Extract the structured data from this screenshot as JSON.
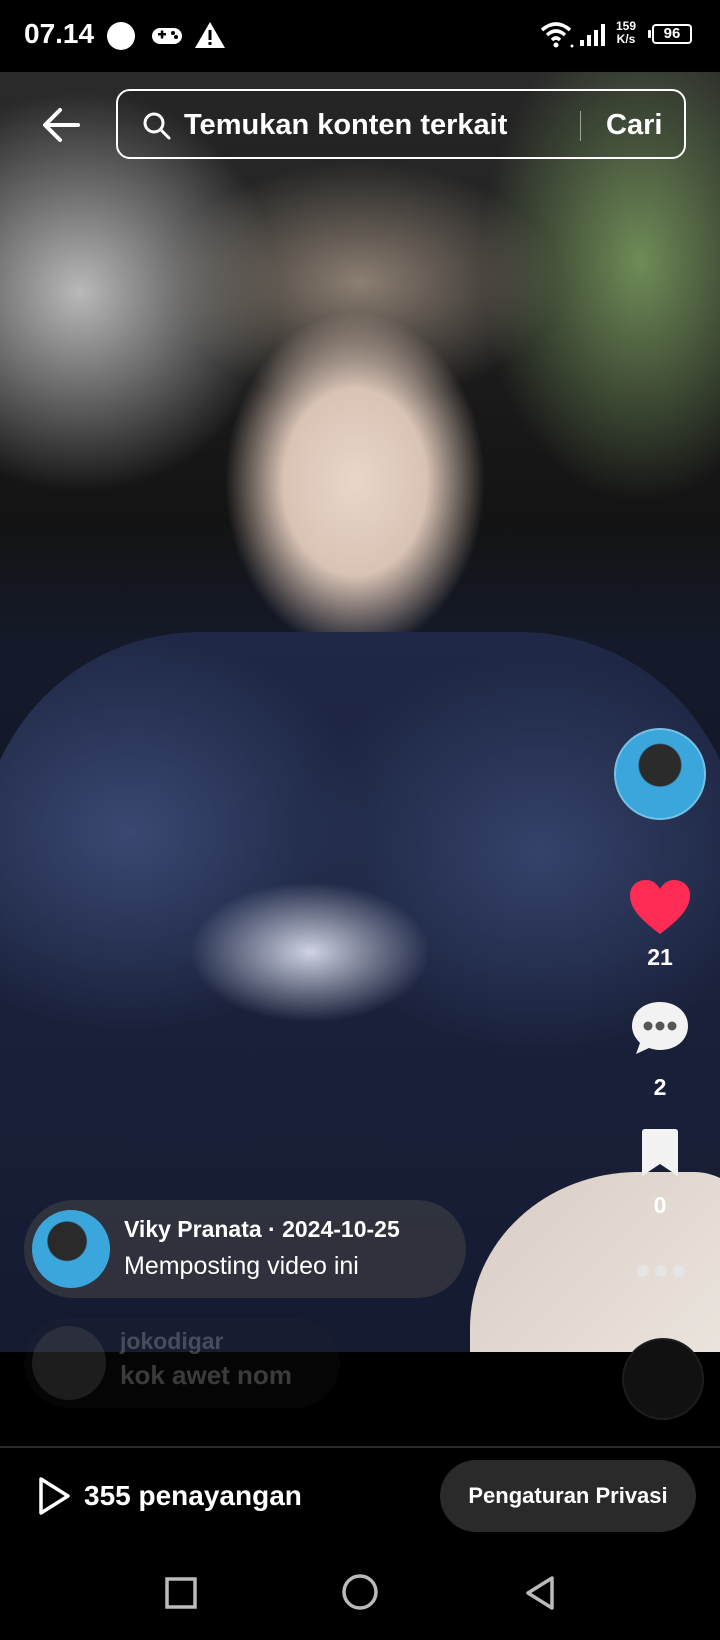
{
  "status_bar": {
    "time": "07.14",
    "speed_value": "159",
    "speed_unit": "K/s",
    "battery": "96",
    "icons": [
      "circle-icon",
      "gamepad-icon",
      "warning-icon",
      "wifi-icon",
      "signal-icon"
    ]
  },
  "search": {
    "placeholder": "Temukan konten terkait",
    "button_label": "Cari"
  },
  "actions": {
    "likes": "21",
    "comments": "2",
    "saves": "0"
  },
  "post": {
    "author_line": "Viky Pranata · 2024-10-25",
    "action": "Memposting video ini"
  },
  "comment": {
    "user": "jokodigar",
    "text": "kok awet nom"
  },
  "footer": {
    "views": "355 penayangan",
    "privacy_button": "Pengaturan Privasi"
  },
  "colors": {
    "like": "#fe2c55",
    "background": "#000000"
  }
}
